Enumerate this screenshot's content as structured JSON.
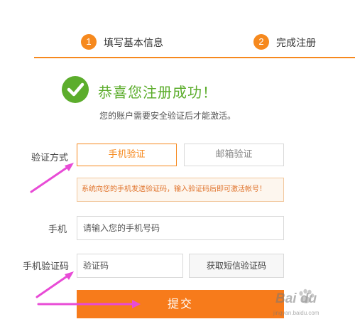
{
  "steps": [
    {
      "number": "1",
      "label": "填写基本信息"
    },
    {
      "number": "2",
      "label": "完成注册"
    }
  ],
  "success": {
    "title": "恭喜您注册成功！",
    "subtitle": "您的账户需要安全验证后才能激活。"
  },
  "form": {
    "verify_method_label": "验证方式",
    "tabs": [
      {
        "label": "手机验证",
        "active": true
      },
      {
        "label": "邮箱验证",
        "active": false
      }
    ],
    "notice": "系统向您的手机发送验证码，输入验证码后即可激活帐号！",
    "phone_label": "手机",
    "phone_placeholder": "请输入您的手机号码",
    "code_label": "手机验证码",
    "code_placeholder": "验证码",
    "sms_button": "获取短信验证码",
    "submit_button": "提交"
  },
  "watermark": {
    "brand": "Bai du",
    "url": "jingyan.baidu.com"
  },
  "colors": {
    "accent": "#f6891e",
    "success": "#5cad2c",
    "submit": "#f77b1b",
    "annotation_arrow": "#e84bd6"
  }
}
